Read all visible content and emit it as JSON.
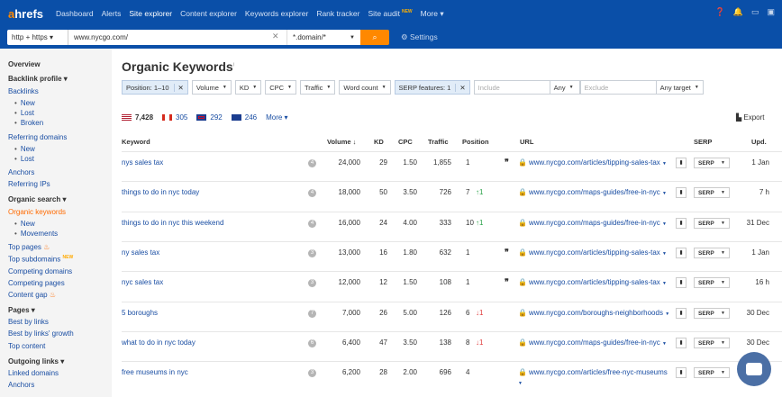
{
  "nav": {
    "logo_a": "a",
    "logo_rest": "hrefs",
    "items": [
      "Dashboard",
      "Alerts",
      "Site explorer",
      "Content explorer",
      "Keywords explorer",
      "Rank tracker",
      "Site audit",
      "More ▾"
    ],
    "new_badge": "NEW"
  },
  "search": {
    "protocol": "http + https ▾",
    "url": "www.nycgo.com/",
    "mode": "*.domain/*",
    "settings": "Settings"
  },
  "sidebar": {
    "overview": "Overview",
    "backlink_profile": "Backlink profile ▾",
    "backlinks": "Backlinks",
    "bl_new": "New",
    "bl_lost": "Lost",
    "bl_broken": "Broken",
    "referring_domains": "Referring domains",
    "rd_new": "New",
    "rd_lost": "Lost",
    "anchors": "Anchors",
    "referring_ips": "Referring IPs",
    "organic_search": "Organic search ▾",
    "organic_keywords": "Organic keywords",
    "ok_new": "New",
    "ok_movements": "Movements",
    "top_pages": "Top pages",
    "top_subdomains": "Top subdomains",
    "new_badge": "NEW",
    "competing_domains": "Competing domains",
    "competing_pages": "Competing pages",
    "content_gap": "Content gap",
    "pages": "Pages ▾",
    "best_by_links": "Best by links",
    "best_by_links_growth": "Best by links' growth",
    "top_content": "Top content",
    "outgoing_links": "Outgoing links ▾",
    "linked_domains": "Linked domains",
    "anchors2": "Anchors"
  },
  "page": {
    "title": "Organic Keywords",
    "info": "i"
  },
  "filters": {
    "position": "Position: 1–10",
    "volume": "Volume",
    "kd": "KD",
    "cpc": "CPC",
    "traffic": "Traffic",
    "word_count": "Word count",
    "serp_features": "SERP features: 1",
    "include": "Include",
    "any1": "Any",
    "exclude": "Exclude",
    "any_target": "Any target"
  },
  "countries": [
    {
      "count": "7,428",
      "color": "#3c5ba8"
    },
    {
      "count": "305",
      "color": "#d52b1e"
    },
    {
      "count": "292",
      "color": "#1b3d8f"
    },
    {
      "count": "246",
      "color": "#1b3d8f"
    }
  ],
  "more": "More ▾",
  "export": "Export",
  "columns": {
    "keyword": "Keyword",
    "volume": "Volume",
    "kd": "KD",
    "cpc": "CPC",
    "traffic": "Traffic",
    "position": "Position",
    "url": "URL",
    "serp": "SERP",
    "upd": "Upd."
  },
  "rows": [
    {
      "kw": "nys sales tax",
      "info": "4",
      "vol": "24,000",
      "kd": "29",
      "cpc": "1.50",
      "traffic": "1,855",
      "pos": "1",
      "chg": "",
      "dir": "",
      "quote": "❞",
      "url": "www.nycgo.com/articles/tipping-sales-tax",
      "serp": "SERP",
      "upd": "1 Jan"
    },
    {
      "kw": "things to do in nyc today",
      "info": "4",
      "vol": "18,000",
      "kd": "50",
      "cpc": "3.50",
      "traffic": "726",
      "pos": "7",
      "chg": "↑1",
      "dir": "up",
      "quote": "",
      "url": "www.nycgo.com/maps-guides/free-in-nyc",
      "serp": "SERP",
      "upd": "7 h"
    },
    {
      "kw": "things to do in nyc this weekend",
      "info": "4",
      "vol": "16,000",
      "kd": "24",
      "cpc": "4.00",
      "traffic": "333",
      "pos": "10",
      "chg": "↑1",
      "dir": "up",
      "quote": "",
      "url": "www.nycgo.com/maps-guides/free-in-nyc",
      "serp": "SERP",
      "upd": "31 Dec"
    },
    {
      "kw": "ny sales tax",
      "info": "3",
      "vol": "13,000",
      "kd": "16",
      "cpc": "1.80",
      "traffic": "632",
      "pos": "1",
      "chg": "",
      "dir": "",
      "quote": "❞",
      "url": "www.nycgo.com/articles/tipping-sales-tax",
      "serp": "SERP",
      "upd": "1 Jan"
    },
    {
      "kw": "nyc sales tax",
      "info": "3",
      "vol": "12,000",
      "kd": "12",
      "cpc": "1.50",
      "traffic": "108",
      "pos": "1",
      "chg": "",
      "dir": "",
      "quote": "❞",
      "url": "www.nycgo.com/articles/tipping-sales-tax",
      "serp": "SERP",
      "upd": "16 h"
    },
    {
      "kw": "5 boroughs",
      "info": "7",
      "vol": "7,000",
      "kd": "26",
      "cpc": "5.00",
      "traffic": "126",
      "pos": "6",
      "chg": "↓1",
      "dir": "down",
      "quote": "",
      "url": "www.nycgo.com/boroughs-neighborhoods",
      "serp": "SERP",
      "upd": "30 Dec"
    },
    {
      "kw": "what to do in nyc today",
      "info": "6",
      "vol": "6,400",
      "kd": "47",
      "cpc": "3.50",
      "traffic": "138",
      "pos": "8",
      "chg": "↓1",
      "dir": "down",
      "quote": "",
      "url": "www.nycgo.com/maps-guides/free-in-nyc",
      "serp": "SERP",
      "upd": "30 Dec"
    },
    {
      "kw": "free museums in nyc",
      "info": "3",
      "vol": "6,200",
      "kd": "28",
      "cpc": "2.00",
      "traffic": "696",
      "pos": "4",
      "chg": "",
      "dir": "",
      "quote": "",
      "url": "www.nycgo.com/articles/free-nyc-museums",
      "serp": "SERP",
      "upd": "30 Dec"
    }
  ]
}
